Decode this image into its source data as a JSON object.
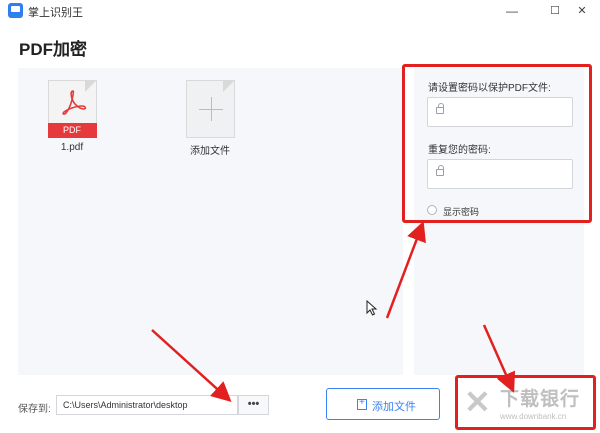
{
  "window": {
    "title": "掌上识别王",
    "minimize": "—",
    "maximize": "☐",
    "close": "✕"
  },
  "page": {
    "title": "PDF加密"
  },
  "files": [
    {
      "name": "1.pdf",
      "badge": "PDF"
    },
    {
      "name": "添加文件"
    }
  ],
  "password_panel": {
    "set_label": "请设置密码以保护PDF文件:",
    "set_value": "",
    "repeat_label": "重复您的密码:",
    "repeat_value": "",
    "show_password_label": "显示密码",
    "show_password_checked": false
  },
  "bottom": {
    "save_to_label": "保存到:",
    "path": "C:\\Users\\Administrator\\desktop",
    "browse_label": "•••",
    "add_file_label": "添加文件"
  },
  "watermark": {
    "text": "下载银行",
    "url": "www.downbank.cn"
  },
  "colors": {
    "accent": "#3b82f6",
    "pdf_red": "#e5393b",
    "annotation_red": "#e32020",
    "panel_bg": "#f5f7fa"
  }
}
